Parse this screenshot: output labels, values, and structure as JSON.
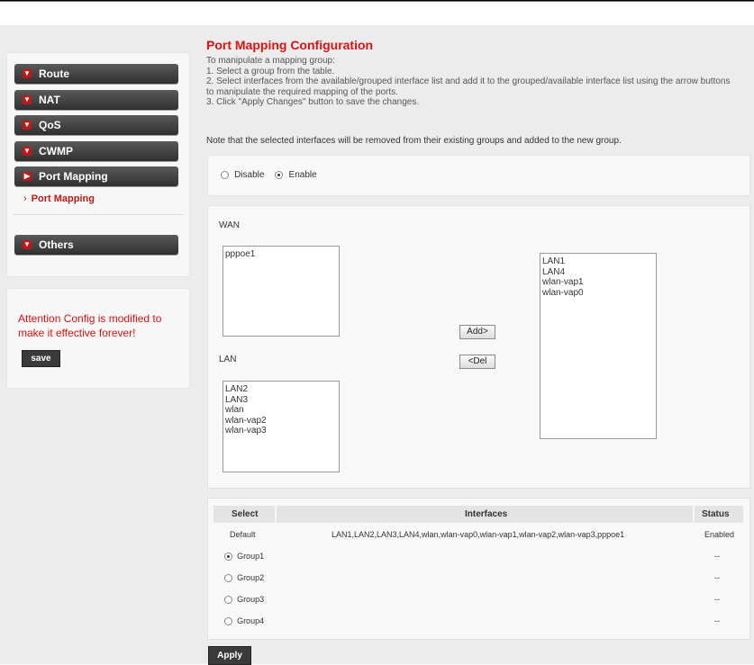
{
  "sidebar": {
    "menu": [
      {
        "label": "Route",
        "icon": "chevron-down-icon"
      },
      {
        "label": "NAT",
        "icon": "chevron-down-icon"
      },
      {
        "label": "QoS",
        "icon": "chevron-down-icon"
      },
      {
        "label": "CWMP",
        "icon": "chevron-down-icon"
      },
      {
        "label": "Port Mapping",
        "icon": "chevron-right-icon"
      }
    ],
    "submenu_item": "Port Mapping",
    "others": "Others",
    "attention": "Attention Config is modified to make it effective forever!",
    "save_label": "save"
  },
  "main": {
    "title": "Port Mapping Configuration",
    "intro": [
      "To manipulate a mapping group:",
      "1. Select a group from the table.",
      "2. Select interfaces from the available/grouped interface list and add it to the grouped/available interface list using the arrow buttons",
      "to manipulate the required mapping of the ports.",
      "3. Click \"Apply Changes\" button to save the changes."
    ],
    "note": "Note that the selected interfaces will be removed from their existing groups and added to the new group.",
    "mode": {
      "disable": "Disable",
      "enable": "Enable",
      "selected": "enable"
    },
    "wan_label": "WAN",
    "lan_label": "LAN",
    "wan_list": [
      "pppoe1"
    ],
    "lan_list": [
      "LAN2",
      "LAN3",
      "wlan",
      "wlan-vap2",
      "wlan-vap3"
    ],
    "grouped_list": [
      "LAN1",
      "LAN4",
      "wlan-vap1",
      "wlan-vap0"
    ],
    "add_label": "Add>",
    "del_label": "<Del",
    "table": {
      "headers": {
        "select": "Select",
        "interfaces": "Interfaces",
        "status": "Status"
      },
      "default_row": {
        "select": "Default",
        "interfaces": "LAN1,LAN2,LAN3,LAN4,wlan,wlan-vap0,wlan-vap1,wlan-vap2,wlan-vap3,pppoe1",
        "status": "Enabled"
      },
      "groups": [
        {
          "label": "Group1",
          "status": "--",
          "selected": true
        },
        {
          "label": "Group2",
          "status": "--",
          "selected": false
        },
        {
          "label": "Group3",
          "status": "--",
          "selected": false
        },
        {
          "label": "Group4",
          "status": "--",
          "selected": false
        }
      ]
    },
    "apply_label": "Apply"
  },
  "colors": {
    "accent_red": "#d11111",
    "button_dark": "#3a3a3a"
  }
}
